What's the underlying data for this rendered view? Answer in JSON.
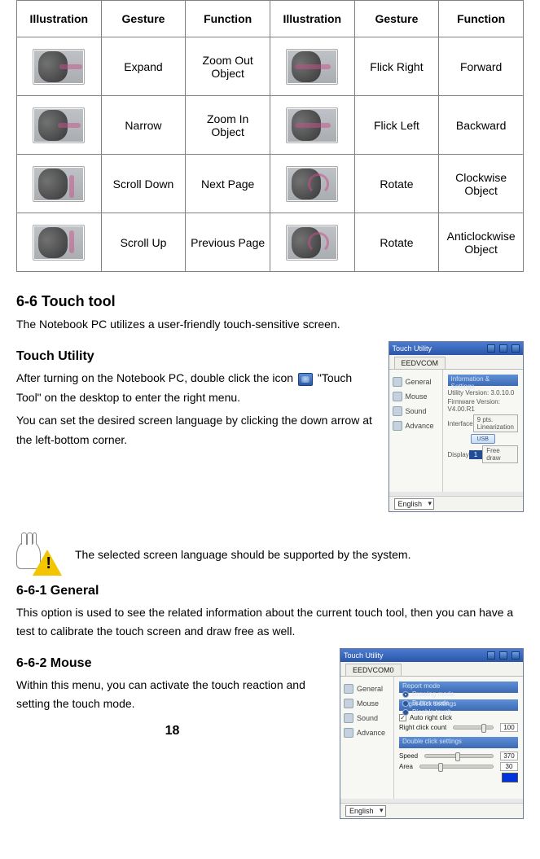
{
  "table": {
    "headers": [
      "Illustration",
      "Gesture",
      "Function",
      "Illustration",
      "Gesture",
      "Function"
    ],
    "rows": [
      {
        "g1": "Expand",
        "f1": "Zoom Out Object",
        "g2": "Flick Right",
        "f2": "Forward"
      },
      {
        "g1": "Narrow",
        "f1": "Zoom In Object",
        "g2": "Flick Left",
        "f2": "Backward"
      },
      {
        "g1": "Scroll Down",
        "f1": "Next Page",
        "g2": "Rotate",
        "f2": "Clockwise Object"
      },
      {
        "g1": "Scroll Up",
        "f1": "Previous Page",
        "g2": "Rotate",
        "f2": "Anticlockwise Object"
      }
    ]
  },
  "section_touch_tool": {
    "heading": "6-6 Touch tool",
    "intro": "The Notebook PC utilizes a user-friendly touch-sensitive screen."
  },
  "touch_utility": {
    "heading": "Touch Utility",
    "para1a": "After turning on the Notebook PC, double click the icon",
    "para1b": "\"Touch Tool\" on the desktop to enter the right menu.",
    "para2": "You can set the desired screen language by clicking the down arrow at the left-bottom corner."
  },
  "warning": "The selected screen language should be supported by the system.",
  "general": {
    "heading": "6-6-1 General",
    "body": "This option is used to see the related information about the current touch tool, then you can have a test to calibrate the touch screen and draw free as well."
  },
  "mouse": {
    "heading": "6-6-2 Mouse",
    "body": "Within this menu, you can activate the touch reaction and setting the touch mode."
  },
  "appwin1": {
    "title": "Touch Utility",
    "tab": "EEDVCOM",
    "side": [
      "General",
      "Mouse",
      "Sound",
      "Advance"
    ],
    "strip_info": "Information & Settings",
    "utility_version": "Utility Version: 3.0.10.0",
    "firmware_version": "Firmware Version: V4.00.R1",
    "interface": "Interface",
    "usb": "USB",
    "display": "Display",
    "display_val": "1",
    "btn_linearization": "9 pts. Linearization",
    "btn_freedraw": "Free draw",
    "language": "English"
  },
  "appwin2": {
    "title": "Touch Utility",
    "tab": "EEDVCOM0",
    "side": [
      "General",
      "Mouse",
      "Sound",
      "Advance"
    ],
    "strip_report": "Report mode",
    "opt_drawing": "Drawing mode",
    "opt_button": "Button mode",
    "opt_disable": "Disable touch",
    "strip_right": "Right click settings",
    "auto_right": "Auto right click",
    "right_count_label": "Right click count",
    "right_count_val": "100",
    "strip_double": "Double click settings",
    "speed_label": "Speed",
    "speed_val": "370",
    "area_label": "Area",
    "area_val": "30",
    "language": "English"
  },
  "page_number": "18"
}
